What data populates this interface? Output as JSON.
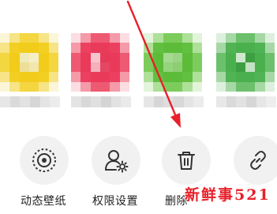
{
  "share_sheet": {
    "apps": [
      {
        "name": "",
        "color": "#f2d02e"
      },
      {
        "name": "",
        "color": "#ee4a62"
      },
      {
        "name": "",
        "color": "#6cc64a"
      },
      {
        "name": "",
        "color": "#56b85a"
      }
    ],
    "actions": [
      {
        "label": "动态壁纸",
        "icon": "live-wallpaper-icon"
      },
      {
        "label": "权限设置",
        "icon": "user-permission-icon"
      },
      {
        "label": "删除",
        "icon": "trash-icon"
      },
      {
        "label": "",
        "icon": "link-icon"
      }
    ]
  },
  "annotation": {
    "arrow_color": "#e8202a",
    "watermark": "新鲜事521"
  }
}
